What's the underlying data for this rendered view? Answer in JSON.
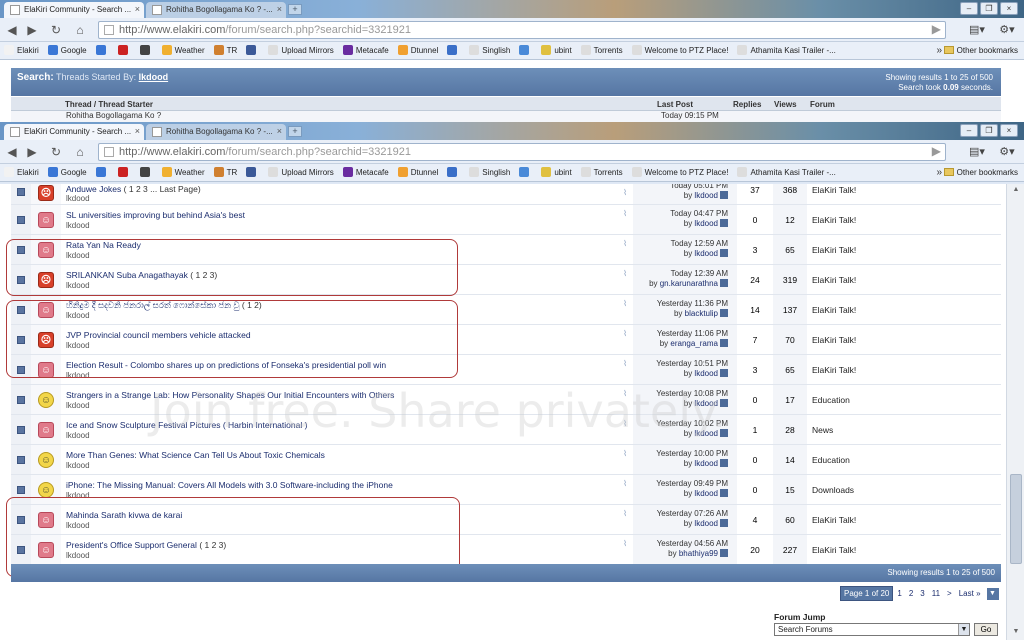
{
  "tabs": [
    {
      "label": "ElaKiri Community - Search ..."
    },
    {
      "label": "Rohitha Bogollagama Ko ? -..."
    }
  ],
  "url": {
    "domain": "http://www.elakiri.com",
    "path": "/forum/search.php?searchid=3321921"
  },
  "bookmarks": [
    {
      "label": "Elakiri",
      "color": "#f2f2f2"
    },
    {
      "label": "Google",
      "color": "#3a77d6"
    },
    {
      "label": "",
      "color": "#3a77d6"
    },
    {
      "label": "",
      "color": "#cc2222"
    },
    {
      "label": "",
      "color": "#444444"
    },
    {
      "label": "Weather",
      "color": "#f0b030"
    },
    {
      "label": "TR",
      "color": "#d08030"
    },
    {
      "label": "",
      "color": "#3b5998"
    },
    {
      "label": "Upload Mirrors",
      "color": "#dddddd"
    },
    {
      "label": "Metacafe",
      "color": "#6a2ca0"
    },
    {
      "label": "Dtunnel",
      "color": "#f0a030"
    },
    {
      "label": "",
      "color": "#3a6fc8"
    },
    {
      "label": "Singlish",
      "color": "#dddddd"
    },
    {
      "label": "",
      "color": "#4a8ad8"
    },
    {
      "label": "ubint",
      "color": "#e0c040"
    },
    {
      "label": "Torrents",
      "color": "#dddddd"
    },
    {
      "label": "Welcome to PTZ Place!",
      "color": "#dddddd"
    },
    {
      "label": "Athamita Kasi Trailer -...",
      "color": "#dddddd"
    }
  ],
  "bookmarks_other": "Other bookmarks",
  "search": {
    "label": "Search:",
    "threads_started_by": "Threads Started By:",
    "user": "lkdood",
    "showing": "Showing results 1 to 25 of 500",
    "took_prefix": "Search took",
    "took_value": "0.09",
    "took_suffix": "seconds."
  },
  "columns": {
    "thread": "Thread / Thread Starter",
    "last_post": "Last Post",
    "replies": "Replies",
    "views": "Views",
    "forum": "Forum"
  },
  "peek_row": {
    "title": "Rohitha Bogollagama Ko ?",
    "date": "Today 09:15 PM"
  },
  "threads": [
    {
      "icon": "red",
      "title": "Anduwe Jokes",
      "pages": "( 1 2 3 ... Last Page)",
      "starter": "lkdood",
      "date": "Today 05:01 PM",
      "by": "lkdood",
      "replies": "37",
      "views": "368",
      "forum": "ElaKiri Talk!"
    },
    {
      "icon": "pink",
      "title": "SL universities improving but behind Asia's best",
      "pages": "",
      "starter": "lkdood",
      "date": "Today 04:47 PM",
      "by": "lkdood",
      "replies": "0",
      "views": "12",
      "forum": "ElaKiri Talk!"
    },
    {
      "icon": "pink",
      "title": "Rata Yan Na Ready",
      "pages": "",
      "starter": "lkdood",
      "date": "Today 12:59 AM",
      "by": "lkdood",
      "replies": "3",
      "views": "65",
      "forum": "ElaKiri Talk!"
    },
    {
      "icon": "red",
      "title": "SRILANKAN Suba Anagathayak",
      "pages": "( 1 2 3)",
      "starter": "lkdood",
      "date": "Today 12:39 AM",
      "by": "gn.karunarathna",
      "replies": "24",
      "views": "319",
      "forum": "ElaKiri Talk!"
    },
    {
      "icon": "pink",
      "title": "හිනිදුම දී සදවනි ජනරාල් සරත් ෆොන්සේකා ජන වු",
      "pages": "( 1 2)",
      "starter": "lkdood",
      "date": "Yesterday 11:36 PM",
      "by": "blacktulip",
      "replies": "14",
      "views": "137",
      "forum": "ElaKiri Talk!"
    },
    {
      "icon": "red",
      "title": "JVP Provincial council members vehicle attacked",
      "pages": "",
      "starter": "lkdood",
      "date": "Yesterday 11:06 PM",
      "by": "eranga_rama",
      "replies": "7",
      "views": "70",
      "forum": "ElaKiri Talk!"
    },
    {
      "icon": "pink",
      "title": "Election Result - Colombo shares up on predictions of Fonseka's presidential poll win",
      "pages": "",
      "starter": "lkdood",
      "date": "Yesterday 10:51 PM",
      "by": "lkdood",
      "replies": "3",
      "views": "65",
      "forum": "ElaKiri Talk!"
    },
    {
      "icon": "yellow",
      "title": "Strangers in a Strange Lab: How Personality Shapes Our Initial Encounters with Others",
      "pages": "",
      "starter": "lkdood",
      "date": "Yesterday 10:08 PM",
      "by": "lkdood",
      "replies": "0",
      "views": "17",
      "forum": "Education"
    },
    {
      "icon": "pink",
      "title": "Ice and Snow Sculpture Festival Pictures ( Harbin International )",
      "pages": "",
      "starter": "lkdood",
      "date": "Yesterday 10:02 PM",
      "by": "lkdood",
      "replies": "1",
      "views": "28",
      "forum": "News"
    },
    {
      "icon": "yellow",
      "title": "More Than Genes: What Science Can Tell Us About Toxic Chemicals",
      "pages": "",
      "starter": "lkdood",
      "date": "Yesterday 10:00 PM",
      "by": "lkdood",
      "replies": "0",
      "views": "14",
      "forum": "Education"
    },
    {
      "icon": "yellow",
      "title": "iPhone: The Missing Manual: Covers All Models with 3.0 Software-including the iPhone",
      "pages": "",
      "starter": "lkdood",
      "date": "Yesterday 09:49 PM",
      "by": "lkdood",
      "replies": "0",
      "views": "15",
      "forum": "Downloads"
    },
    {
      "icon": "pink",
      "title": "Mahinda Sarath kivwa de karai",
      "pages": "",
      "starter": "lkdood",
      "date": "Yesterday 07:26 AM",
      "by": "lkdood",
      "replies": "4",
      "views": "60",
      "forum": "ElaKiri Talk!"
    },
    {
      "icon": "pink",
      "title": "President's Office Support General",
      "pages": "( 1 2 3)",
      "starter": "lkdood",
      "date": "Yesterday 04:56 AM",
      "by": "bhathiya99",
      "replies": "20",
      "views": "227",
      "forum": "ElaKiri Talk!"
    }
  ],
  "footer": {
    "showing": "Showing results 1 to 25 of 500"
  },
  "pager": {
    "current": "Page 1 of 20",
    "pages": [
      "1",
      "2",
      "3",
      "11",
      ">",
      "Last »"
    ]
  },
  "forum_jump": {
    "label": "Forum Jump",
    "selected": "Search Forums",
    "go": "Go"
  },
  "watermark": "Join free. Share privately."
}
